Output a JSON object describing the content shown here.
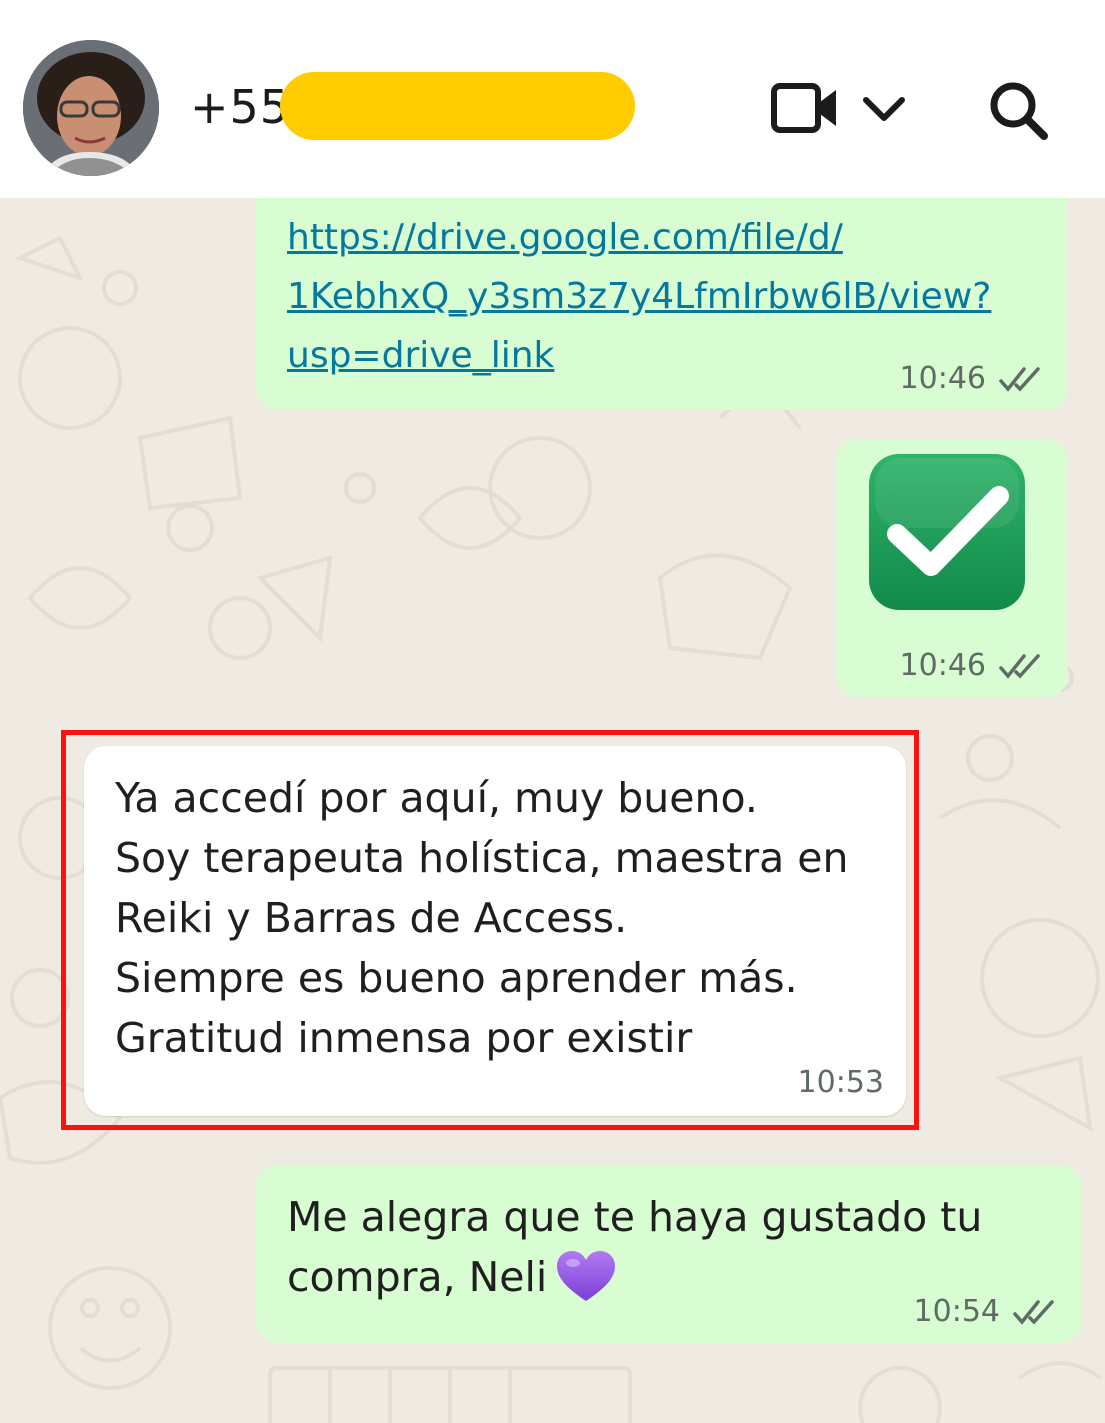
{
  "header": {
    "contact_prefix": "+55",
    "icons": [
      "avatar",
      "video-call-icon",
      "chevron-down-icon",
      "search-icon"
    ],
    "redaction_color": "#ffcc00"
  },
  "messages": [
    {
      "direction": "outgoing",
      "type": "link",
      "lines": [
        "https://drive.google.com/file/d/",
        "1KebhxQ_y3sm3z7y4LfmIrbw6lB/view?",
        "usp=drive_link"
      ],
      "time": "10:46",
      "status_icon": "double-check-icon"
    },
    {
      "direction": "outgoing",
      "type": "emoji",
      "emoji_icon": "check-mark-button-icon",
      "time": "10:46",
      "status_icon": "double-check-icon"
    },
    {
      "direction": "incoming",
      "type": "text",
      "highlighted": true,
      "lines": [
        "Ya accedí por aquí, muy bueno.",
        "Soy terapeuta holística, maestra en",
        "Reiki y Barras de Access.",
        "Siempre es bueno aprender más.",
        "Gratitud inmensa por existir"
      ],
      "time": "10:53"
    },
    {
      "direction": "outgoing",
      "type": "text",
      "lines": [
        "Me alegra que te haya gustado tu",
        "compra, Neli"
      ],
      "trailing_emoji_icon": "purple-heart-icon",
      "time": "10:54",
      "status_icon": "double-check-icon"
    }
  ],
  "colors": {
    "header_bg": "#ffffff",
    "chat_bg": "#efeae2",
    "outgoing_bubble": "#d9fdd3",
    "incoming_bubble": "#ffffff",
    "link": "#06789e",
    "highlight_border": "#ff1010"
  }
}
